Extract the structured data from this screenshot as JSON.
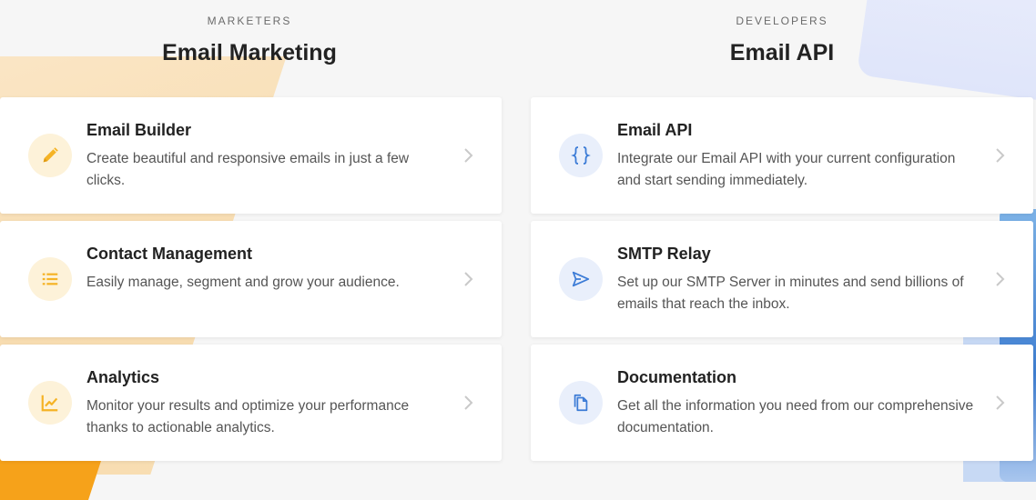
{
  "marketers": {
    "eyebrow": "MARKETERS",
    "title": "Email Marketing",
    "cards": [
      {
        "title": "Email Builder",
        "description": "Create beautiful and responsive emails in just a few clicks.",
        "icon": "pencil-icon"
      },
      {
        "title": "Contact Management",
        "description": "Easily manage, segment and grow your audience.",
        "icon": "list-icon"
      },
      {
        "title": "Analytics",
        "description": "Monitor your results and optimize your performance thanks to actionable analytics.",
        "icon": "chart-icon"
      }
    ]
  },
  "developers": {
    "eyebrow": "DEVELOPERS",
    "title": "Email API",
    "cards": [
      {
        "title": "Email API",
        "description": "Integrate our Email API with your current configuration and start sending immediately.",
        "icon": "braces-icon"
      },
      {
        "title": "SMTP Relay",
        "description": "Set up our SMTP Server in minutes and send billions of emails that reach the inbox.",
        "icon": "send-icon"
      },
      {
        "title": "Documentation",
        "description": "Get all the information you need from our comprehensive documentation.",
        "icon": "document-icon"
      }
    ]
  },
  "colors": {
    "accent_yellow": "#f5b325",
    "accent_blue": "#3b7bd6",
    "background": "#f6f6f6"
  }
}
